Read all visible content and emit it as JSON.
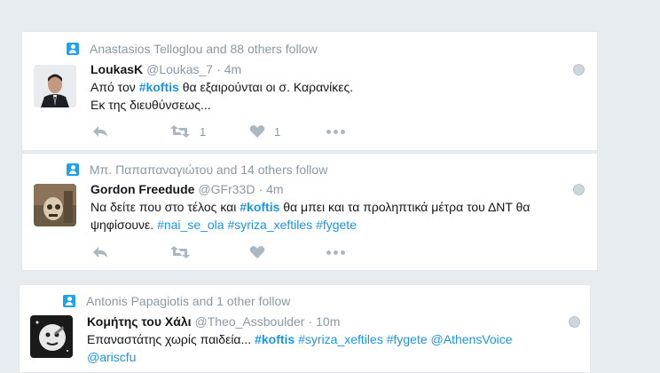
{
  "colors": {
    "accent": "#1da1f2",
    "link": "#1b95e0",
    "muted": "#8899a6",
    "background": "#e6ecf0"
  },
  "tweets": [
    {
      "context": "Anastasios Telloglou and 88 others follow",
      "fullname": "LoukasK",
      "handle": "@Loukas_7",
      "dot": "·",
      "time": "4m",
      "text": [
        [
          {
            "t": "Από τον "
          },
          {
            "t": "#koftis",
            "h": "strong"
          },
          {
            "t": " θα εξαιρούνται οι σ. Καρανίκες."
          }
        ],
        [
          {
            "t": "Εκ της διευθύνσεως..."
          }
        ]
      ],
      "retweets": "1",
      "likes": "1"
    },
    {
      "context": "Μπ. Παπαπαναγιώτου and 14 others follow",
      "fullname": "Gordon Freedude",
      "handle": "@GFr33D",
      "dot": "·",
      "time": "4m",
      "text": [
        [
          {
            "t": "Να δείτε που στο τέλος και "
          },
          {
            "t": "#koftis",
            "h": "strong"
          },
          {
            "t": " θα μπει και τα προληπτικά μέτρα του ΔΝΤ θα"
          }
        ],
        [
          {
            "t": "ψηφίσουνε. "
          },
          {
            "t": "#nai_se_ola",
            "h": "light"
          },
          {
            "t": " "
          },
          {
            "t": "#syriza_xeftiles",
            "h": "light"
          },
          {
            "t": " "
          },
          {
            "t": "#fygete",
            "h": "light"
          }
        ]
      ],
      "retweets": "",
      "likes": ""
    },
    {
      "context": "Antonis Papagiotis and 1 other follow",
      "fullname": "Κομήτης του Χάλι",
      "handle": "@Theo_Assboulder",
      "dot": "·",
      "time": "10m",
      "text": [
        [
          {
            "t": "Επαναστάτης χωρίς παιδεία... "
          },
          {
            "t": "#koftis",
            "h": "strong"
          },
          {
            "t": " "
          },
          {
            "t": "#syriza_xeftiles",
            "h": "light"
          },
          {
            "t": " "
          },
          {
            "t": "#fygete",
            "h": "light"
          },
          {
            "t": " "
          },
          {
            "t": "@AthensVoice",
            "h": "light"
          }
        ],
        [
          {
            "t": "@ariscfu",
            "h": "light"
          }
        ]
      ],
      "retweets": "",
      "likes": ""
    }
  ]
}
